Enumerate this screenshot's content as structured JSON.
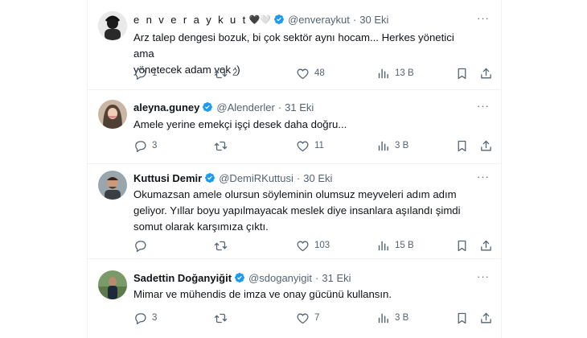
{
  "colors": {
    "verified": "#1d9bf0",
    "text": "#0f1419",
    "muted": "#536471",
    "divider": "#eff3f4"
  },
  "tweets": [
    {
      "display_name": "e n v e r a y k u t",
      "emojis": "🖤🤍",
      "handle": "@enveraykut",
      "date": "30 Eki",
      "text_lines": [
        "Arz talep dengesi bozuk, bi çok sektör aynı hocam... Herkes yönetici ama",
        "yönetecek adam yok :)"
      ],
      "replies": "1",
      "reposts": "2",
      "likes": "48",
      "views": "13 B"
    },
    {
      "display_name": "aleyna.guney",
      "handle": "@Alenderler",
      "date": "31 Eki",
      "text_lines": [
        "Amele yerine emekçi işçi desek daha doğru..."
      ],
      "replies": "3",
      "reposts": "",
      "likes": "11",
      "views": "3 B"
    },
    {
      "display_name": "Kuttusi Demir",
      "handle": "@DemiRKuttusi",
      "date": "30 Eki",
      "text_lines": [
        "Okumazsan amele olursun söyleminin olumsuz meyveleri adım adım",
        "geliyor. Yıllar boyu yapılmayacak meslek diye insanlara aşılandı şimdi",
        "somut olarak karşımıza çıktı."
      ],
      "replies": "",
      "reposts": "",
      "likes": "103",
      "views": "15 B"
    },
    {
      "display_name": "Sadettin Doğanyiğit",
      "handle": "@sdoganyigit",
      "date": "31 Eki",
      "text_lines": [
        "Mimar ve mühendis de imza ve onay gücünü kullansın."
      ],
      "replies": "3",
      "reposts": "",
      "likes": "7",
      "views": "3 B"
    }
  ],
  "icons": {
    "verified": "verified-badge-icon",
    "more": "more-options-icon",
    "reply": "reply-icon",
    "repost": "repost-icon",
    "like": "like-icon",
    "views": "views-icon",
    "bookmark": "bookmark-icon",
    "share": "share-icon"
  },
  "more_glyph": "···"
}
